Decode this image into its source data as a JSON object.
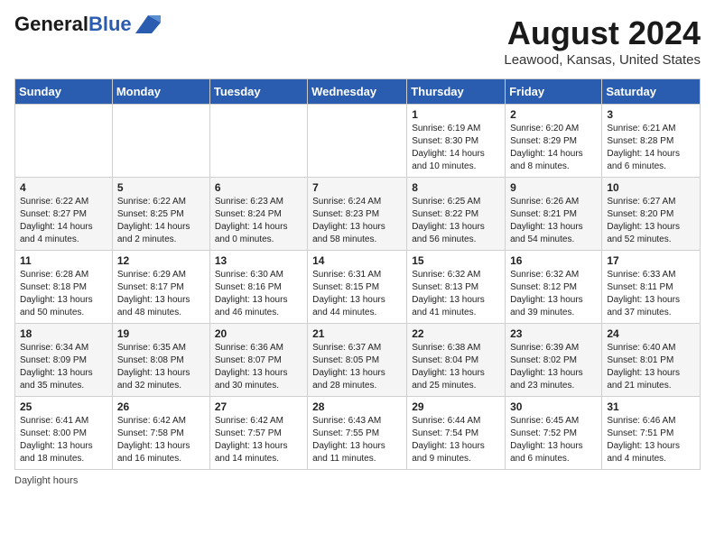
{
  "header": {
    "logo_line1": "General",
    "logo_line2": "Blue",
    "month_year": "August 2024",
    "location": "Leawood, Kansas, United States"
  },
  "weekdays": [
    "Sunday",
    "Monday",
    "Tuesday",
    "Wednesday",
    "Thursday",
    "Friday",
    "Saturday"
  ],
  "weeks": [
    [
      {
        "day": "",
        "info": ""
      },
      {
        "day": "",
        "info": ""
      },
      {
        "day": "",
        "info": ""
      },
      {
        "day": "",
        "info": ""
      },
      {
        "day": "1",
        "info": "Sunrise: 6:19 AM\nSunset: 8:30 PM\nDaylight: 14 hours and 10 minutes."
      },
      {
        "day": "2",
        "info": "Sunrise: 6:20 AM\nSunset: 8:29 PM\nDaylight: 14 hours and 8 minutes."
      },
      {
        "day": "3",
        "info": "Sunrise: 6:21 AM\nSunset: 8:28 PM\nDaylight: 14 hours and 6 minutes."
      }
    ],
    [
      {
        "day": "4",
        "info": "Sunrise: 6:22 AM\nSunset: 8:27 PM\nDaylight: 14 hours and 4 minutes."
      },
      {
        "day": "5",
        "info": "Sunrise: 6:22 AM\nSunset: 8:25 PM\nDaylight: 14 hours and 2 minutes."
      },
      {
        "day": "6",
        "info": "Sunrise: 6:23 AM\nSunset: 8:24 PM\nDaylight: 14 hours and 0 minutes."
      },
      {
        "day": "7",
        "info": "Sunrise: 6:24 AM\nSunset: 8:23 PM\nDaylight: 13 hours and 58 minutes."
      },
      {
        "day": "8",
        "info": "Sunrise: 6:25 AM\nSunset: 8:22 PM\nDaylight: 13 hours and 56 minutes."
      },
      {
        "day": "9",
        "info": "Sunrise: 6:26 AM\nSunset: 8:21 PM\nDaylight: 13 hours and 54 minutes."
      },
      {
        "day": "10",
        "info": "Sunrise: 6:27 AM\nSunset: 8:20 PM\nDaylight: 13 hours and 52 minutes."
      }
    ],
    [
      {
        "day": "11",
        "info": "Sunrise: 6:28 AM\nSunset: 8:18 PM\nDaylight: 13 hours and 50 minutes."
      },
      {
        "day": "12",
        "info": "Sunrise: 6:29 AM\nSunset: 8:17 PM\nDaylight: 13 hours and 48 minutes."
      },
      {
        "day": "13",
        "info": "Sunrise: 6:30 AM\nSunset: 8:16 PM\nDaylight: 13 hours and 46 minutes."
      },
      {
        "day": "14",
        "info": "Sunrise: 6:31 AM\nSunset: 8:15 PM\nDaylight: 13 hours and 44 minutes."
      },
      {
        "day": "15",
        "info": "Sunrise: 6:32 AM\nSunset: 8:13 PM\nDaylight: 13 hours and 41 minutes."
      },
      {
        "day": "16",
        "info": "Sunrise: 6:32 AM\nSunset: 8:12 PM\nDaylight: 13 hours and 39 minutes."
      },
      {
        "day": "17",
        "info": "Sunrise: 6:33 AM\nSunset: 8:11 PM\nDaylight: 13 hours and 37 minutes."
      }
    ],
    [
      {
        "day": "18",
        "info": "Sunrise: 6:34 AM\nSunset: 8:09 PM\nDaylight: 13 hours and 35 minutes."
      },
      {
        "day": "19",
        "info": "Sunrise: 6:35 AM\nSunset: 8:08 PM\nDaylight: 13 hours and 32 minutes."
      },
      {
        "day": "20",
        "info": "Sunrise: 6:36 AM\nSunset: 8:07 PM\nDaylight: 13 hours and 30 minutes."
      },
      {
        "day": "21",
        "info": "Sunrise: 6:37 AM\nSunset: 8:05 PM\nDaylight: 13 hours and 28 minutes."
      },
      {
        "day": "22",
        "info": "Sunrise: 6:38 AM\nSunset: 8:04 PM\nDaylight: 13 hours and 25 minutes."
      },
      {
        "day": "23",
        "info": "Sunrise: 6:39 AM\nSunset: 8:02 PM\nDaylight: 13 hours and 23 minutes."
      },
      {
        "day": "24",
        "info": "Sunrise: 6:40 AM\nSunset: 8:01 PM\nDaylight: 13 hours and 21 minutes."
      }
    ],
    [
      {
        "day": "25",
        "info": "Sunrise: 6:41 AM\nSunset: 8:00 PM\nDaylight: 13 hours and 18 minutes."
      },
      {
        "day": "26",
        "info": "Sunrise: 6:42 AM\nSunset: 7:58 PM\nDaylight: 13 hours and 16 minutes."
      },
      {
        "day": "27",
        "info": "Sunrise: 6:42 AM\nSunset: 7:57 PM\nDaylight: 13 hours and 14 minutes."
      },
      {
        "day": "28",
        "info": "Sunrise: 6:43 AM\nSunset: 7:55 PM\nDaylight: 13 hours and 11 minutes."
      },
      {
        "day": "29",
        "info": "Sunrise: 6:44 AM\nSunset: 7:54 PM\nDaylight: 13 hours and 9 minutes."
      },
      {
        "day": "30",
        "info": "Sunrise: 6:45 AM\nSunset: 7:52 PM\nDaylight: 13 hours and 6 minutes."
      },
      {
        "day": "31",
        "info": "Sunrise: 6:46 AM\nSunset: 7:51 PM\nDaylight: 13 hours and 4 minutes."
      }
    ]
  ],
  "footer": {
    "note": "Daylight hours"
  }
}
